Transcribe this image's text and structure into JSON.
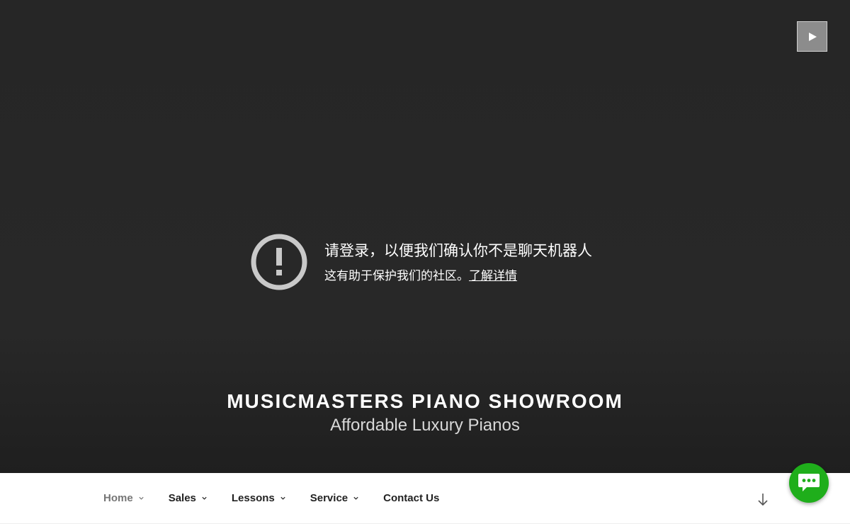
{
  "hero": {
    "notice": {
      "title": "请登录，以便我们确认你不是聊天机器人",
      "subtitle": "这有助于保护我们的社区。",
      "link": "了解详情",
      "icon": "exclamation-circle-icon"
    },
    "video_control_icon": "play-icon",
    "site_title": "MUSICMASTERS PIANO SHOWROOM",
    "site_description": "Affordable Luxury Pianos"
  },
  "nav": {
    "items": [
      {
        "label": "Home",
        "has_submenu": true,
        "current": true
      },
      {
        "label": "Sales",
        "has_submenu": true
      },
      {
        "label": "Lessons",
        "has_submenu": true
      },
      {
        "label": "Service",
        "has_submenu": true
      },
      {
        "label": "Contact Us",
        "has_submenu": false
      }
    ],
    "scroll_icon": "arrow-down-icon"
  },
  "chat": {
    "icon": "chat-bubble-icon",
    "color": "#1fae1b"
  }
}
